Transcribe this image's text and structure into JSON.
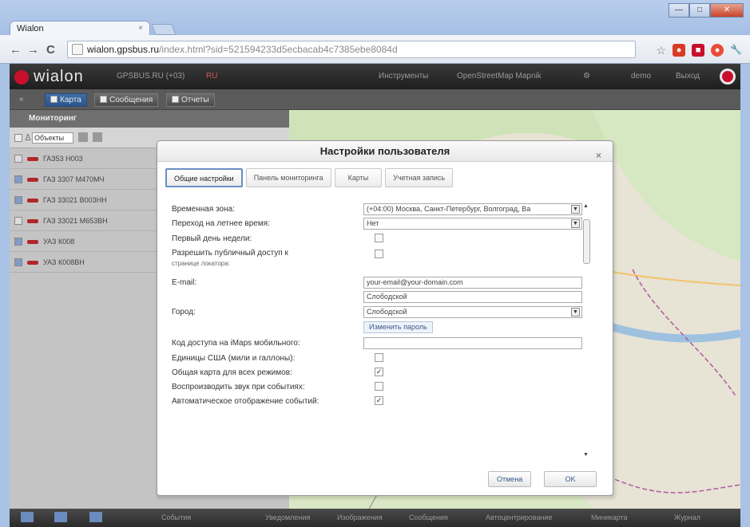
{
  "browser": {
    "tab_title": "Wialon",
    "tab_close": "×",
    "url_host": "wialon.gpsbus.ru",
    "url_path": "/index.html?sid=521594233d5ecbacab4c7385ebe8084d",
    "window_buttons": [
      "—",
      "□",
      "✕"
    ],
    "nav": {
      "back": "←",
      "forward": "→",
      "reload": "C"
    },
    "star": "☆",
    "wrench": "🔧"
  },
  "app": {
    "logo_text": "wialon",
    "header_info": "GPSBUS.RU (+03)",
    "header_flag": "RU",
    "header_tools": "Инструменты",
    "header_map": "OpenStreetMap Mapnik",
    "header_user": "demo",
    "header_exit": "Выход",
    "tabs": [
      {
        "label": "Карта",
        "active": true
      },
      {
        "label": "Сообщения",
        "active": false
      },
      {
        "label": "Отчеты",
        "active": false
      }
    ],
    "monitoring_title": "Мониторинг",
    "objects_select": "Объекты",
    "units": [
      {
        "name": "ГАЗ53 Н003",
        "checked": false
      },
      {
        "name": "ГАЗ 3307 М470МЧ",
        "checked": true
      },
      {
        "name": "ГАЗ 33021 В003НН",
        "checked": true
      },
      {
        "name": "ГАЗ 33021 М653ВН",
        "checked": false
      },
      {
        "name": "УАЗ К008",
        "checked": true
      },
      {
        "name": "УАЗ К008ВН",
        "checked": true
      }
    ],
    "statusbar": {
      "events": "События",
      "notifications": "Уведомления",
      "images": "Изображения",
      "messages": "Сообщения",
      "autocenter": "Автоцентрирование",
      "minimap": "Миникарта",
      "journal": "Журнал"
    }
  },
  "dialog": {
    "title": "Настройки пользователя",
    "close": "×",
    "tabs": [
      "Общие настройки",
      "Панель мониторинга",
      "Карты",
      "Учетная запись"
    ],
    "rows": {
      "timezone_label": "Временная зона:",
      "timezone_value": "(+04:00) Москва, Санкт-Петербург, Волгоград, Ва",
      "dst_label": "Переход на летнее время:",
      "dst_value": "Нет",
      "week_label": "Первый день недели:",
      "public_label": "Разрешить публичный доступ к",
      "public_sub": "странице локатора:",
      "email_label": "E-mail:",
      "email_value": "your-email@your-domain.com",
      "city_label": "Город:",
      "city_value": "Слободской",
      "city_select": "Слободской",
      "change_password": "Изменить пароль",
      "code_label": "Код доступа на iMaps мобильного:",
      "us_units_label": "Единицы США (мили и галлоны):",
      "shared_map_label": "Общая карта для всех режимов:",
      "sound_label": "Воспроизводить звук при событиях:",
      "auto_events_label": "Автоматическое отображение событий:"
    },
    "checks": {
      "week": false,
      "public": false,
      "us_units": false,
      "shared_map": true,
      "sound": false,
      "auto_events": true
    },
    "check_mark": "✓",
    "dropdown_glyph": "▼",
    "cancel": "Отмена",
    "ok": "OK"
  }
}
